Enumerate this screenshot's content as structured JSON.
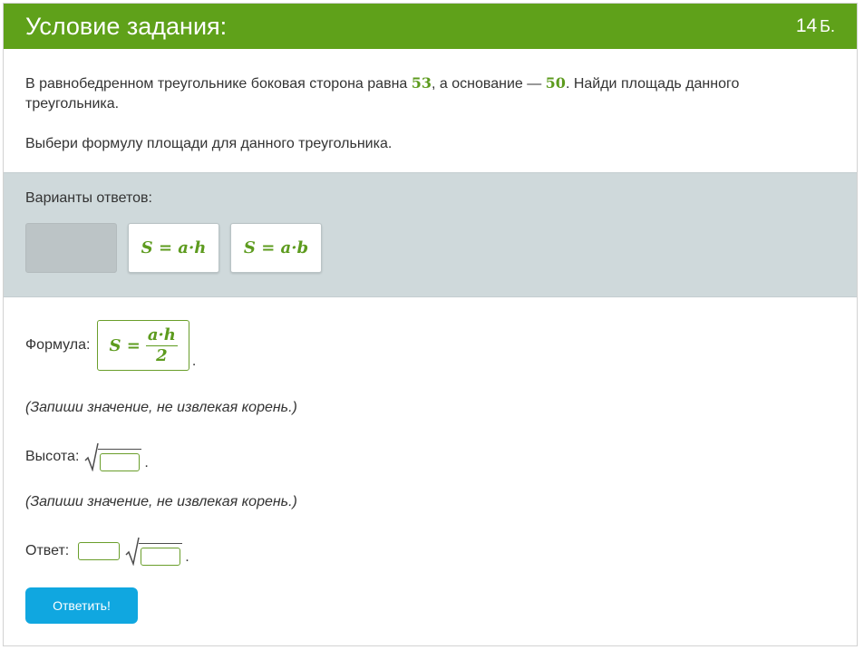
{
  "header": {
    "title": "Условие задания:",
    "points_value": "14",
    "points_unit": "Б."
  },
  "statement": {
    "part1": "В равнобедренном треугольнике боковая сторона равна ",
    "side": "53",
    "part2": ", а основание — ",
    "base": "50",
    "part3": ". Найди площадь данного треугольника.",
    "instruction": "Выбери формулу площади для данного треугольника."
  },
  "variants": {
    "label": "Варианты ответов:",
    "options": [
      "S = a·h",
      "S = a·b"
    ]
  },
  "formula": {
    "label": "Формула:",
    "lhs": "S =",
    "numerator": "a·h",
    "denominator": "2",
    "trailing": "."
  },
  "hint1": "(Запиши значение, не извлекая корень.)",
  "height": {
    "label": "Высота:",
    "trailing": "."
  },
  "hint2": "(Запиши значение, не извлекая корень.)",
  "answer": {
    "label": "Ответ:",
    "trailing": "."
  },
  "submit_label": "Ответить!",
  "colors": {
    "header_bg": "#5fa11a",
    "accent_green": "#5d9b1e",
    "variants_bg": "#cfd9db",
    "button_bg": "#10a7e0"
  }
}
